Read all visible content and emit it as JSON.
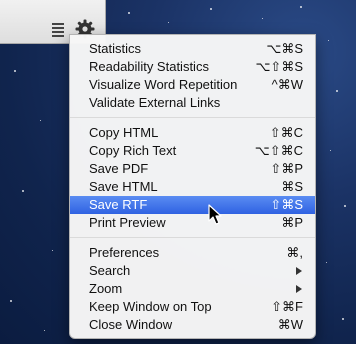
{
  "menu": {
    "groups": [
      {
        "items": [
          {
            "label": "Statistics",
            "shortcut": "⌥⌘S"
          },
          {
            "label": "Readability Statistics",
            "shortcut": "⌥⇧⌘S"
          },
          {
            "label": "Visualize Word Repetition",
            "shortcut": "^⌘W"
          },
          {
            "label": "Validate External Links",
            "shortcut": ""
          }
        ]
      },
      {
        "items": [
          {
            "label": "Copy HTML",
            "shortcut": "⇧⌘C"
          },
          {
            "label": "Copy Rich Text",
            "shortcut": "⌥⇧⌘C"
          },
          {
            "label": "Save PDF",
            "shortcut": "⇧⌘P"
          },
          {
            "label": "Save HTML",
            "shortcut": "⌘S"
          },
          {
            "label": "Save RTF",
            "shortcut": "⇧⌘S"
          },
          {
            "label": "Print Preview",
            "shortcut": "⌘P"
          }
        ]
      },
      {
        "items": [
          {
            "label": "Preferences",
            "shortcut": "⌘,"
          },
          {
            "label": "Search",
            "shortcut": ""
          },
          {
            "label": "Zoom",
            "shortcut": ""
          },
          {
            "label": "Keep Window on Top",
            "shortcut": "⇧⌘F"
          },
          {
            "label": "Close Window",
            "shortcut": "⌘W"
          }
        ]
      }
    ],
    "selected_item": "Save RTF"
  },
  "toolbar": {
    "icons": [
      "list-icon",
      "gear-icon"
    ]
  },
  "colors": {
    "selection": "#3a6ee6",
    "desktop": "#1b3366"
  }
}
